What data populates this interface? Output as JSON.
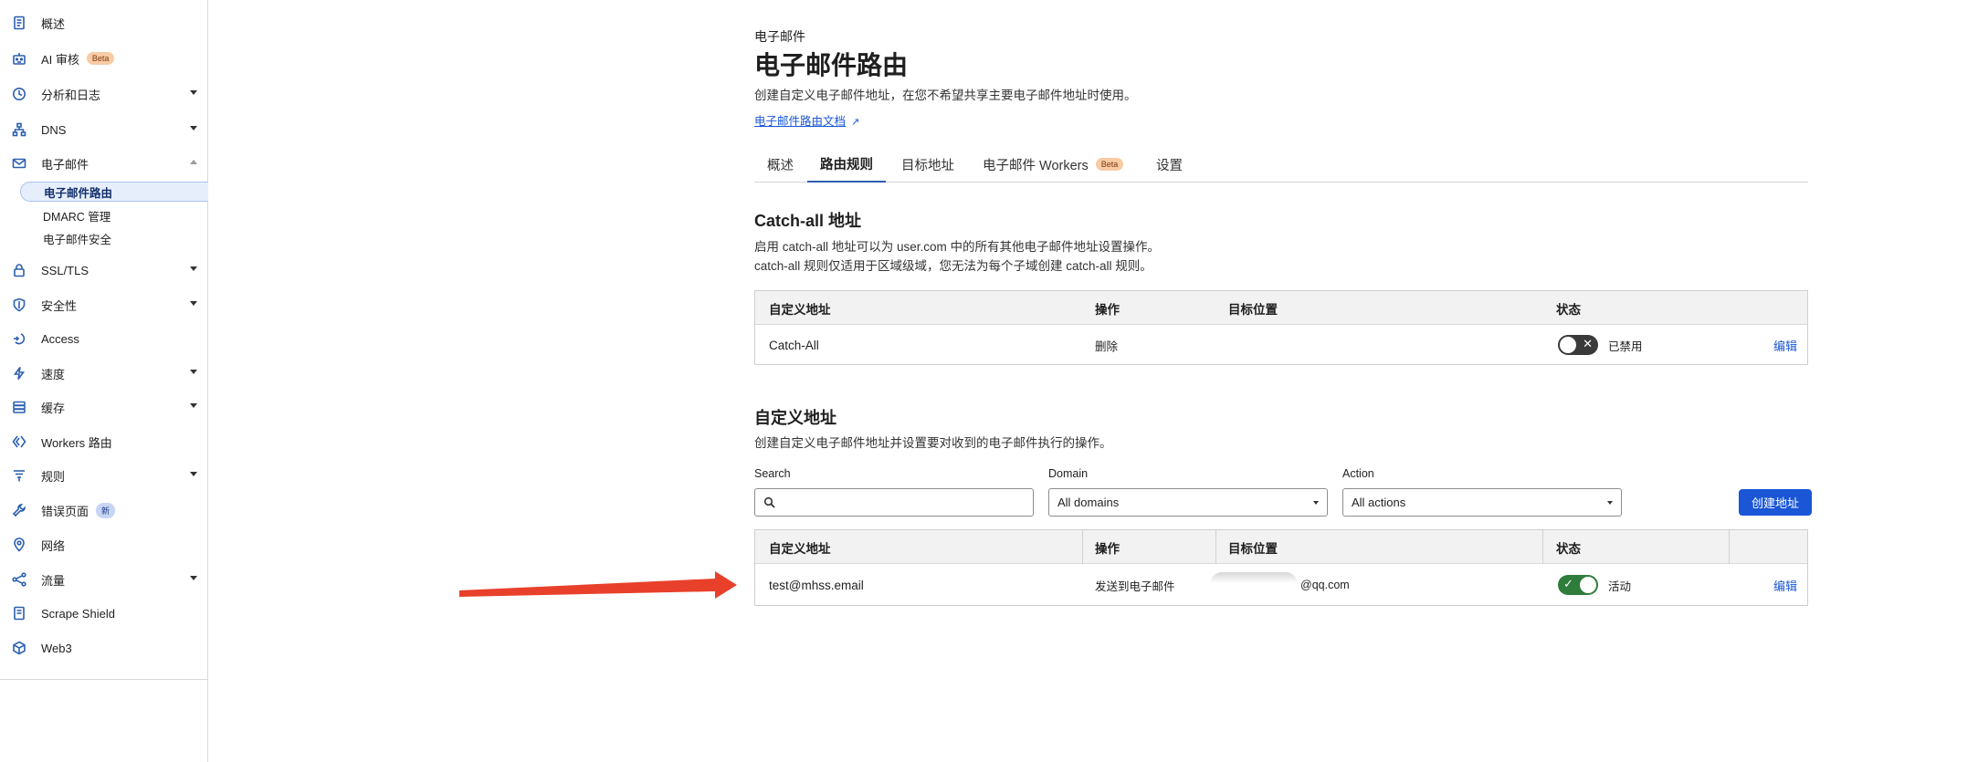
{
  "sidebar": {
    "items": [
      {
        "label": "概述",
        "icon": "document-icon"
      },
      {
        "label": "AI 审核",
        "icon": "robot-icon",
        "badge": "Beta"
      },
      {
        "label": "分析和日志",
        "icon": "clock-chart-icon",
        "expandable": true
      },
      {
        "label": "DNS",
        "icon": "network-tree-icon",
        "expandable": true
      },
      {
        "label": "电子邮件",
        "icon": "envelope-icon",
        "expanded": true
      },
      {
        "label": "SSL/TLS",
        "icon": "lock-icon",
        "expandable": true
      },
      {
        "label": "安全性",
        "icon": "shield-icon",
        "expandable": true
      },
      {
        "label": "Access",
        "icon": "access-arrow-icon"
      },
      {
        "label": "速度",
        "icon": "bolt-icon",
        "expandable": true
      },
      {
        "label": "缓存",
        "icon": "database-icon",
        "expandable": true
      },
      {
        "label": "Workers 路由",
        "icon": "workers-icon"
      },
      {
        "label": "规则",
        "icon": "funnel-icon",
        "expandable": true
      },
      {
        "label": "错误页面",
        "icon": "wrench-icon",
        "badge": "新"
      },
      {
        "label": "网络",
        "icon": "location-pin-icon"
      },
      {
        "label": "流量",
        "icon": "share-nodes-icon",
        "expandable": true
      },
      {
        "label": "Scrape Shield",
        "icon": "page-shield-icon"
      },
      {
        "label": "Web3",
        "icon": "cube-icon"
      }
    ],
    "email_sub": [
      "电子邮件路由",
      "DMARC 管理",
      "电子邮件安全"
    ]
  },
  "header": {
    "kicker": "电子邮件",
    "title": "电子邮件路由",
    "description": "创建自定义电子邮件地址，在您不希望共享主要电子邮件地址时使用。",
    "doc_link": "电子邮件路由文档"
  },
  "tabs": [
    {
      "label": "概述"
    },
    {
      "label": "路由规则",
      "active": true
    },
    {
      "label": "目标地址"
    },
    {
      "label": "电子邮件 Workers",
      "badge": "Beta"
    },
    {
      "label": "设置"
    }
  ],
  "catch_all": {
    "title": "Catch-all 地址",
    "desc_line1": "启用 catch-all 地址可以为 user.com 中的所有其他电子邮件地址设置操作。",
    "desc_line2": "catch-all 规则仅适用于区域级域，您无法为每个子域创建 catch-all 规则。",
    "headers": [
      "自定义地址",
      "操作",
      "目标位置",
      "状态"
    ],
    "row": {
      "address": "Catch-All",
      "action": "删除",
      "destination": "",
      "status": "已禁用",
      "enabled": false,
      "edit": "编辑"
    }
  },
  "custom": {
    "title": "自定义地址",
    "desc": "创建自定义电子邮件地址并设置要对收到的电子邮件执行的操作。",
    "filters": {
      "search_label": "Search",
      "search_value": "",
      "domain_label": "Domain",
      "domain_value": "All domains",
      "action_label": "Action",
      "action_value": "All actions"
    },
    "create_button": "创建地址",
    "headers": [
      "自定义地址",
      "操作",
      "目标位置",
      "状态"
    ],
    "rows": [
      {
        "address": "test@mhss.email",
        "action": "发送到电子邮件",
        "destination_visible": "@qq.com",
        "status": "活动",
        "enabled": true,
        "edit": "编辑"
      }
    ]
  },
  "colors": {
    "accent": "#1a56d6",
    "toggle_on": "#2e7d3b",
    "toggle_off": "#3a3a3a",
    "annotation_arrow": "#e8402a"
  }
}
